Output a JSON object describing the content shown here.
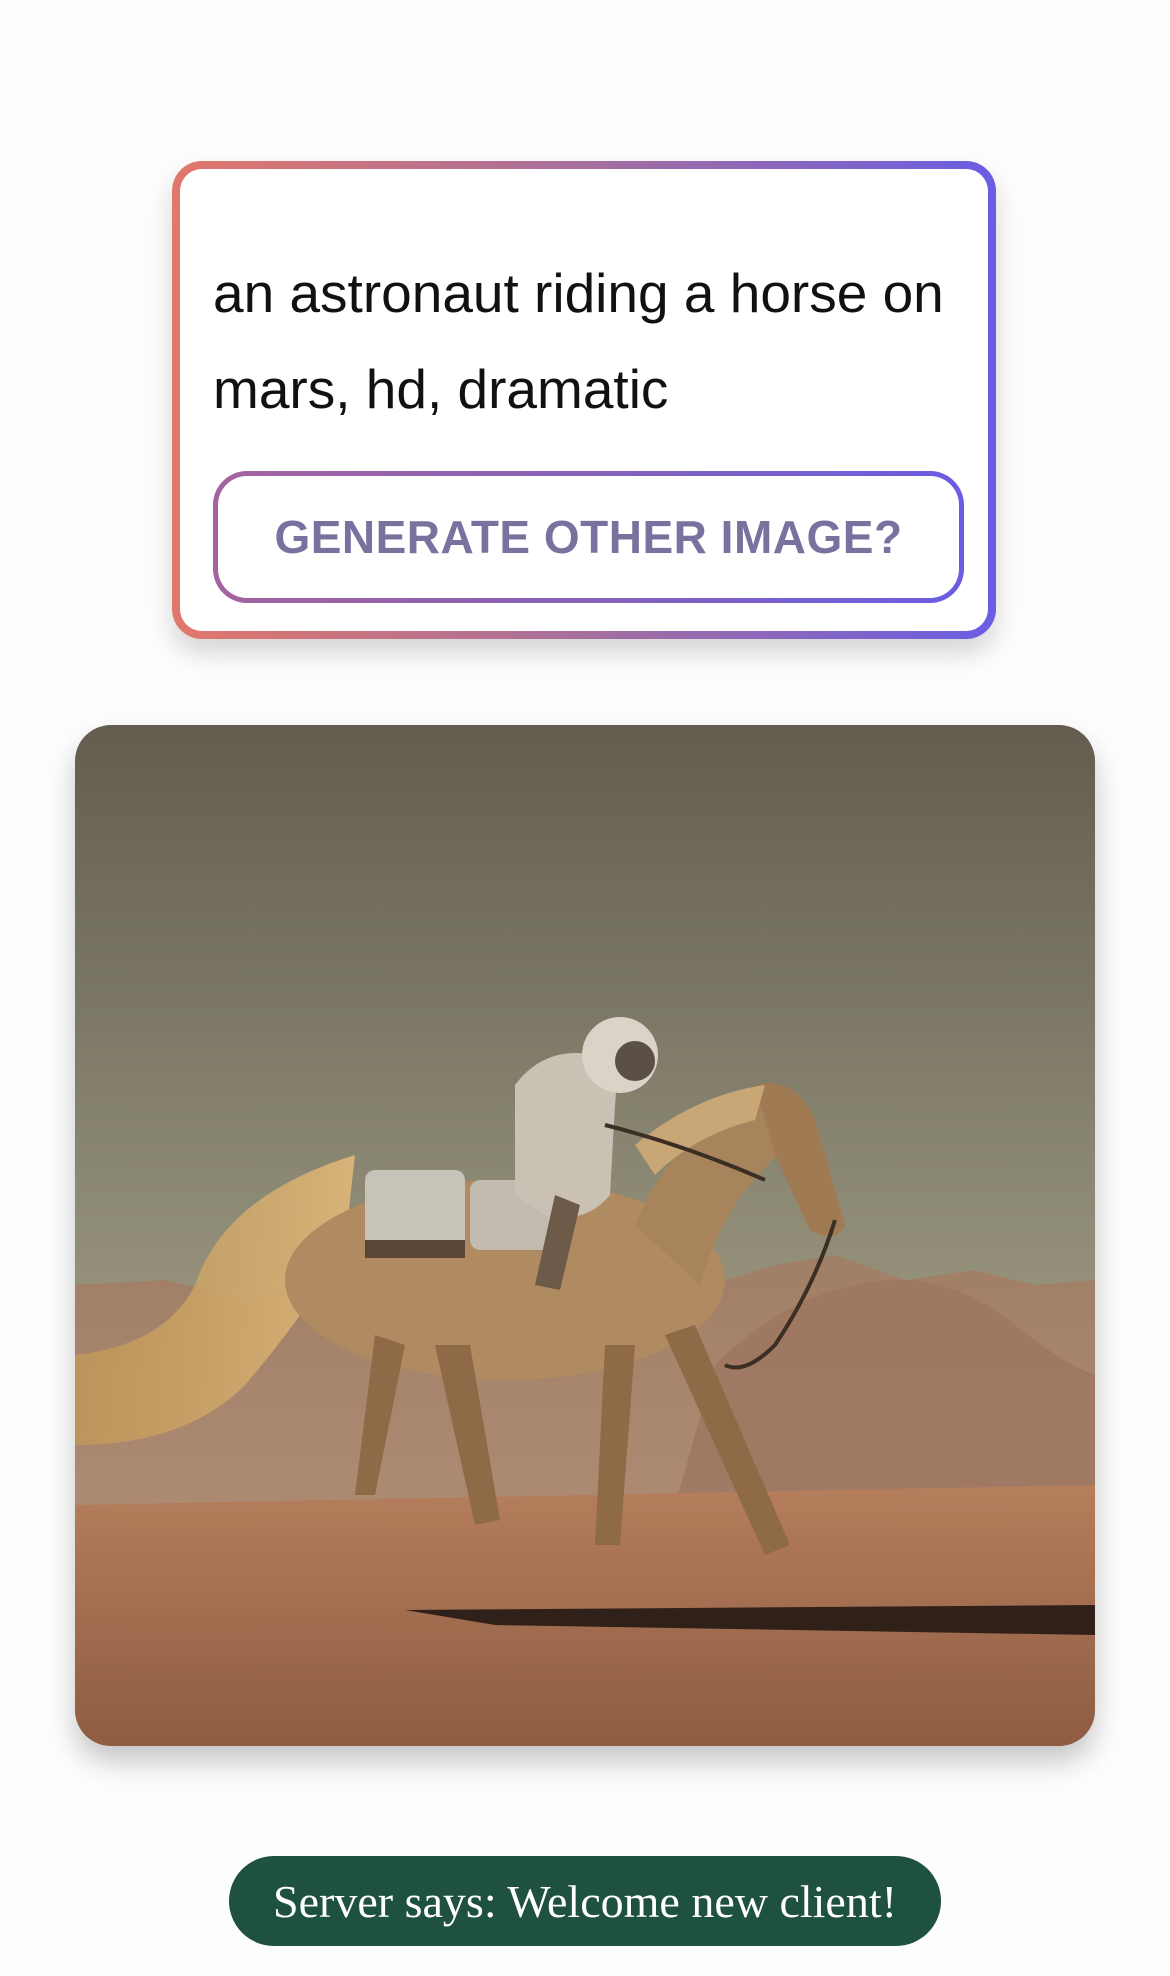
{
  "prompt": {
    "text": "an astronaut riding a horse on mars, hd, dramatic",
    "border_gradient": [
      "#e2776b",
      "#6a5de2"
    ]
  },
  "generate_button": {
    "label": "GENERATE OTHER IMAGE?",
    "text_color": "#7a729e"
  },
  "result_image": {
    "depicts": "astronaut riding a horse on mars"
  },
  "server_message": {
    "text": "Server says: Welcome new client!",
    "background": "#1f5140"
  }
}
